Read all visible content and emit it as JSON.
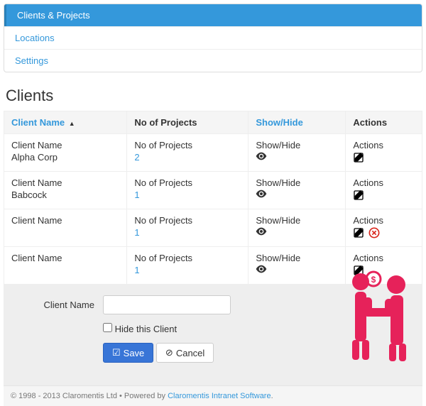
{
  "nav": {
    "items": [
      {
        "label": "Clients & Projects",
        "active": true
      },
      {
        "label": "Locations",
        "active": false
      },
      {
        "label": "Settings",
        "active": false
      }
    ]
  },
  "page_title": "Clients",
  "table": {
    "headers": {
      "client_name": "Client Name",
      "no_of_projects": "No of Projects",
      "show_hide": "Show/Hide",
      "actions": "Actions"
    },
    "rows": [
      {
        "label": "Client Name",
        "name": "Alpha Corp",
        "count_label": "No of Projects",
        "count": "2",
        "sh_label": "Show/Hide",
        "actions_label": "Actions",
        "deletable": false
      },
      {
        "label": "Client Name",
        "name": "Babcock",
        "count_label": "No of Projects",
        "count": "1",
        "sh_label": "Show/Hide",
        "actions_label": "Actions",
        "deletable": false
      },
      {
        "label": "Client Name",
        "name": "",
        "count_label": "No of Projects",
        "count": "1",
        "sh_label": "Show/Hide",
        "actions_label": "Actions",
        "deletable": true
      },
      {
        "label": "Client Name",
        "name": "",
        "count_label": "No of Projects",
        "count": "1",
        "sh_label": "Show/Hide",
        "actions_label": "Actions",
        "deletable": false
      }
    ]
  },
  "form": {
    "client_name_label": "Client Name",
    "client_name_value": "",
    "hide_label": "Hide this Client",
    "save_label": "Save",
    "cancel_label": "Cancel"
  },
  "footer": {
    "text": "© 1998 - 2013 Claromentis Ltd • Powered by ",
    "link": "Claromentis Intranet Software",
    "suffix": "."
  },
  "colors": {
    "accent": "#3498db",
    "crimson": "#e6225a"
  }
}
